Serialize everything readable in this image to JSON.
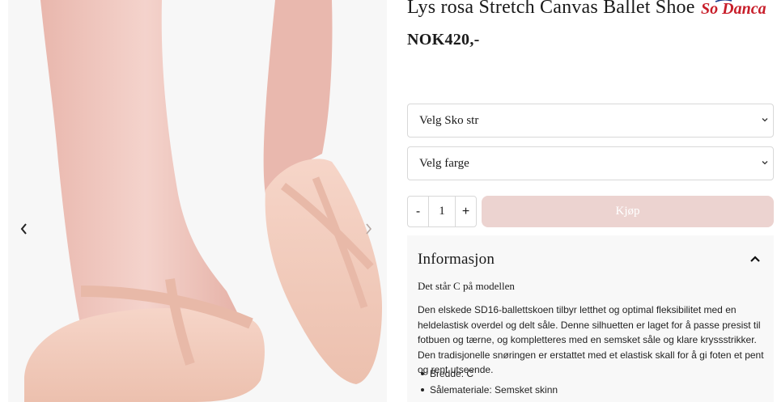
{
  "product": {
    "title": "Lys rosa Stretch Canvas Ballet Shoe",
    "price": "NOK420,-",
    "brand": "So Danca"
  },
  "gallery": {
    "prev_icon": "chevron-left-icon",
    "next_icon": "chevron-right-icon"
  },
  "selects": {
    "size_label": "Velg Sko str",
    "color_label": "Velg farge"
  },
  "quantity": {
    "minus": "-",
    "value": "1",
    "plus": "+"
  },
  "buy_label": "Kjøp",
  "info": {
    "title": "Informasjon",
    "model_note": "Det står C på modellen",
    "description": "Den elskede SD16-ballettskoen tilbyr letthet og optimal fleksibilitet med en heldelastisk overdel og delt såle. Denne silhuetten er laget for å passe presist til fotbuen og tærne, og kompletteres med en semsket såle og klare kryssstrikker. Den tradisjonelle snøringen er erstattet med et elastisk skall for å gi foten et pent og rent utseende.",
    "specs": [
      "Bredde: C",
      "Sålemateriale: Semsket skinn"
    ]
  },
  "colors": {
    "buy_button_bg": "#ecd3d0",
    "shoe": "#f2c8b8",
    "skin": "#f0c9c0"
  }
}
